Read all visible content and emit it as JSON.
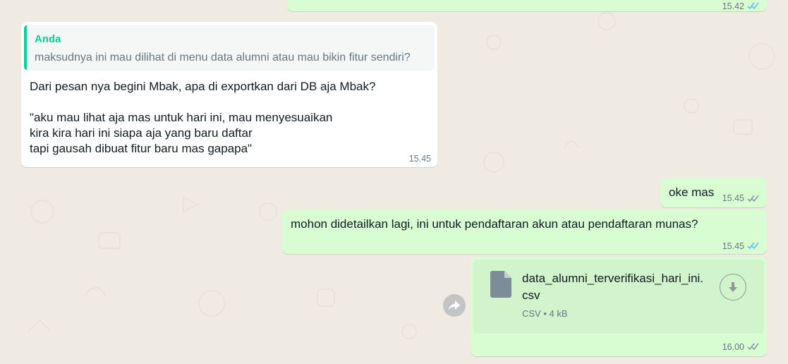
{
  "messages": {
    "top_out": {
      "time": "15.42"
    },
    "reply_in": {
      "quote_author": "Anda",
      "quote_text": "maksudnya ini mau dilihat di menu data alumni atau mau bikin fitur sendiri?",
      "text": "Dari pesan nya begini Mbak, apa di exportkan dari DB aja Mbak?\n\n\"aku mau lihat aja mas untuk hari ini, mau menyesuaikan\nkira kira hari ini siapa aja yang baru daftar\ntapi gausah dibuat fitur baru mas gapapa\"",
      "time": "15.45"
    },
    "oke": {
      "text": "oke mas",
      "time": "15.45",
      "status": "read"
    },
    "mohon": {
      "text": "mohon didetailkan lagi, ini untuk pendaftaran akun atau pendaftaran munas?",
      "time": "15.45",
      "status": "read"
    },
    "file": {
      "name": "data_alumni_terverifikasi_hari_ini.\ncsv",
      "meta_type": "CSV",
      "meta_sep": "•",
      "meta_size": "4 kB",
      "time": "16.00",
      "status": "read"
    }
  },
  "icons": [
    "double-check-icon",
    "file-icon",
    "download-icon",
    "forward-icon"
  ],
  "colors": {
    "outgoing": "#d9fdd3",
    "incoming": "#ffffff",
    "read_ticks": "#53bdeb",
    "quote_accent": "#06cf9c",
    "chat_bg": "#efeae2"
  }
}
